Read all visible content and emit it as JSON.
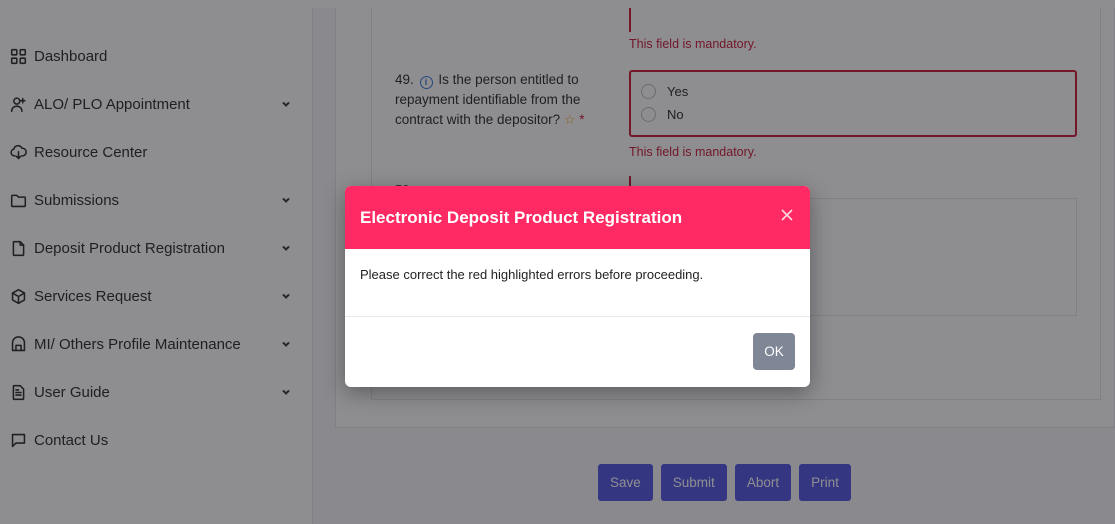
{
  "sidebar": {
    "items": [
      {
        "label": "Dashboard",
        "icon": "grid-icon",
        "has_submenu": false
      },
      {
        "label": "ALO/ PLO Appointment",
        "icon": "user-plus-icon",
        "has_submenu": true
      },
      {
        "label": "Resource Center",
        "icon": "cloud-download-icon",
        "has_submenu": false
      },
      {
        "label": "Submissions",
        "icon": "folder-icon",
        "has_submenu": true
      },
      {
        "label": "Deposit Product Registration",
        "icon": "document-icon",
        "has_submenu": true
      },
      {
        "label": "Services Request",
        "icon": "box-icon",
        "has_submenu": true
      },
      {
        "label": "MI/ Others Profile Maintenance",
        "icon": "bank-icon",
        "has_submenu": true
      },
      {
        "label": "User Guide",
        "icon": "file-text-icon",
        "has_submenu": true
      },
      {
        "label": "Contact Us",
        "icon": "message-icon",
        "has_submenu": false
      }
    ]
  },
  "form": {
    "error_text_top": "This field is mandatory.",
    "question_49": {
      "number": "49.",
      "text": "Is the person entitled to repayment identifiable from the contract with the depositor?",
      "required_mark": "*",
      "options": [
        "Yes",
        "No"
      ],
      "error": "This field is mandatory."
    },
    "question_50_stub": "50.",
    "actions": {
      "save": "Save",
      "submit": "Submit",
      "abort": "Abort",
      "print": "Print"
    }
  },
  "dialog": {
    "title": "Electronic Deposit Product Registration",
    "message": "Please correct the red highlighted errors before proceeding.",
    "ok_label": "OK"
  },
  "colors": {
    "dialog_header": "#ff2a63",
    "error": "#c8102e",
    "primary_button": "#4a4fe0",
    "ok_button": "#7f8797"
  }
}
